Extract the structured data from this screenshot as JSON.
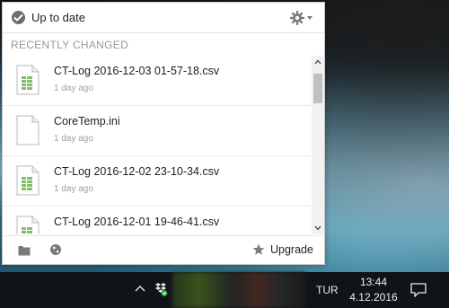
{
  "popup": {
    "status_text": "Up to date",
    "section_title": "RECENTLY CHANGED",
    "files": [
      {
        "name": "CT-Log 2016-12-03 01-57-18.csv",
        "time": "1 day ago",
        "icon": "spreadsheet-file-icon"
      },
      {
        "name": "CoreTemp.ini",
        "time": "1 day ago",
        "icon": "text-file-icon"
      },
      {
        "name": "CT-Log 2016-12-02 23-10-34.csv",
        "time": "1 day ago",
        "icon": "spreadsheet-file-icon"
      },
      {
        "name": "CT-Log 2016-12-01 19-46-41.csv",
        "time": "",
        "icon": "spreadsheet-file-icon"
      }
    ],
    "footer": {
      "upgrade_label": "Upgrade"
    }
  },
  "taskbar": {
    "language": "TUR",
    "time": "13:44",
    "date": "4.12.2016"
  }
}
